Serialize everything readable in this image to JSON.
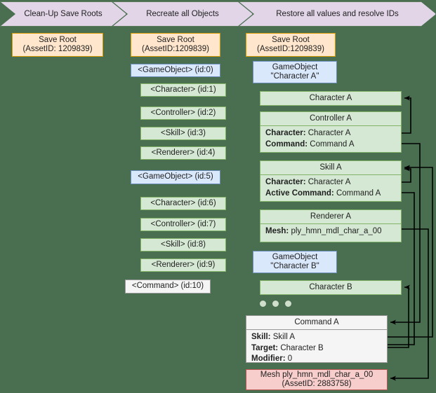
{
  "phases": [
    {
      "label": "Clean-Up Save Roots"
    },
    {
      "label": "Recreate all Objects"
    },
    {
      "label": "Restore all values and resolve IDs"
    }
  ],
  "column1": {
    "save_root": {
      "line1": "Save Root",
      "line2": "(AssetID: 1209839)"
    }
  },
  "column2": {
    "save_root": {
      "line1": "Save Root",
      "line2": "(AssetID:1209839)"
    },
    "nodes": [
      {
        "label": "<GameObject> (id:0)",
        "kind": "gameobject"
      },
      {
        "label": "<Character> (id:1)",
        "kind": "component"
      },
      {
        "label": "<Controller> (id:2)",
        "kind": "component"
      },
      {
        "label": "<Skill> (id:3)",
        "kind": "component"
      },
      {
        "label": "<Renderer> (id:4)",
        "kind": "component"
      },
      {
        "label": "<GameObject> (id:5)",
        "kind": "gameobject"
      },
      {
        "label": "<Character> (id:6)",
        "kind": "component"
      },
      {
        "label": "<Controller> (id:7)",
        "kind": "component"
      },
      {
        "label": "<Skill> (id:8)",
        "kind": "component"
      },
      {
        "label": "<Renderer> (id:9)",
        "kind": "component"
      },
      {
        "label": "<Command> (id:10)",
        "kind": "plain"
      }
    ]
  },
  "column3": {
    "save_root": {
      "line1": "Save Root",
      "line2": "(AssetID:1209839)"
    },
    "gameobject_a": {
      "line1": "GameObject",
      "line2": "\"Character A\""
    },
    "character_a": {
      "title": "Character A"
    },
    "controller_a": {
      "title": "Controller A",
      "fields": [
        {
          "key": "Character:",
          "value": "Character A"
        },
        {
          "key": "Command:",
          "value": "Command A"
        }
      ]
    },
    "skill_a": {
      "title": "Skill A",
      "fields": [
        {
          "key": "Character:",
          "value": "Character A"
        },
        {
          "key": "Active Command:",
          "value": "Command A"
        }
      ]
    },
    "renderer_a": {
      "title": "Renderer A",
      "fields": [
        {
          "key": "Mesh:",
          "value": "ply_hmn_mdl_char_a_00"
        }
      ]
    },
    "gameobject_b": {
      "line1": "GameObject",
      "line2": "\"Character B\""
    },
    "character_b": {
      "title": "Character B"
    },
    "ellipsis": "• • •",
    "command_a": {
      "title": "Command A",
      "fields": [
        {
          "key": "Skill:",
          "value": "Skill A"
        },
        {
          "key": "Target:",
          "value": "Character B"
        },
        {
          "key": "Modifier:",
          "value": "0"
        }
      ]
    },
    "mesh_asset": {
      "line1": "Mesh ply_hmn_mdl_char_a_00",
      "line2": "(AssetID: 2883758)"
    }
  },
  "colors": {
    "background": "#4a6e50",
    "phase_fill": "#e1d5e7",
    "phase_border": "#5d7a5d",
    "saveroot_fill": "#ffe6cc",
    "saveroot_border": "#d79b00",
    "gameobject_fill": "#dae8fc",
    "gameobject_border": "#6c8ebf",
    "component_fill": "#d5e8d4",
    "component_border": "#82b366",
    "plain_fill": "#f5f5f5",
    "plain_border": "#999999",
    "mesh_fill": "#f8cecc",
    "mesh_border": "#b85450",
    "connector": "#000000",
    "text": "#1f1f1f"
  }
}
